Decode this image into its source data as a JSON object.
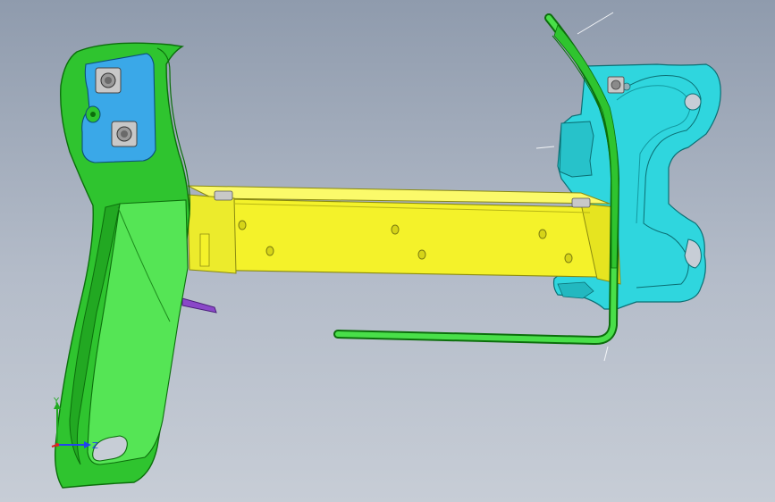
{
  "viewport": {
    "background_top": "#8f9bad",
    "background_bottom": "#c7cdd6"
  },
  "colors": {
    "green_bracket": "#2fc42f",
    "green_dark": "#0c6e0c",
    "green_light": "#55e555",
    "cyan_plate": "#2fd6de",
    "cyan_dark": "#0b6f74",
    "blue_pad": "#3aa8e8",
    "yellow_beam": "#f4f22a",
    "yellow_dark": "#8a8a10",
    "purple_tab": "#8a47c8",
    "nut_gray": "#c8c8c8"
  },
  "parts": [
    {
      "id": "left-bracket",
      "color_name": "green"
    },
    {
      "id": "crossbeam",
      "color_name": "yellow"
    },
    {
      "id": "right-mount-plate",
      "color_name": "cyan"
    },
    {
      "id": "bent-rod",
      "color_name": "green"
    },
    {
      "id": "purple-tab",
      "color_name": "purple"
    }
  ],
  "axis_triad": {
    "y_label": "Y",
    "z_label": "Z",
    "y_color": "#22aa22",
    "z_color": "#2244ee",
    "x_color": "#dd2222"
  }
}
